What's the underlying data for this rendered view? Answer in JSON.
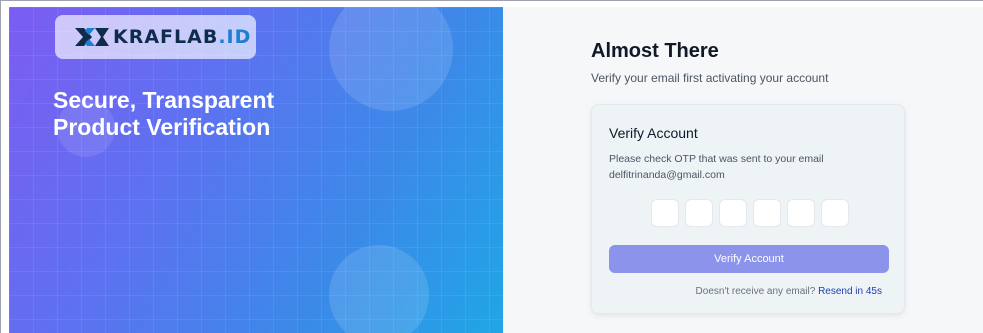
{
  "brand": {
    "logo_main": "KRAFLAB",
    "logo_suffix": ".ID",
    "tagline": "Secure, Transparent Product Verification",
    "colors": {
      "gradient_start": "#7c5cf2",
      "gradient_end": "#20a6e6",
      "logo_dark": "#0f2d4a",
      "logo_blue": "#1d7fd1"
    }
  },
  "page": {
    "title": "Almost There",
    "subtitle": "Verify your email first activating your account"
  },
  "card": {
    "title": "Verify Account",
    "description": "Please check OTP that was sent to your email",
    "email": "delfitrinanda@gmail.com",
    "otp": {
      "digits": [
        "",
        "",
        "",
        "",
        "",
        ""
      ],
      "icon": "none"
    },
    "button_label": "Verify Account",
    "button_color": "#8b93ea",
    "resend_prompt": "Doesn't receive any email?",
    "resend_link": "Resend in 45s",
    "link_color": "#1e40af"
  }
}
